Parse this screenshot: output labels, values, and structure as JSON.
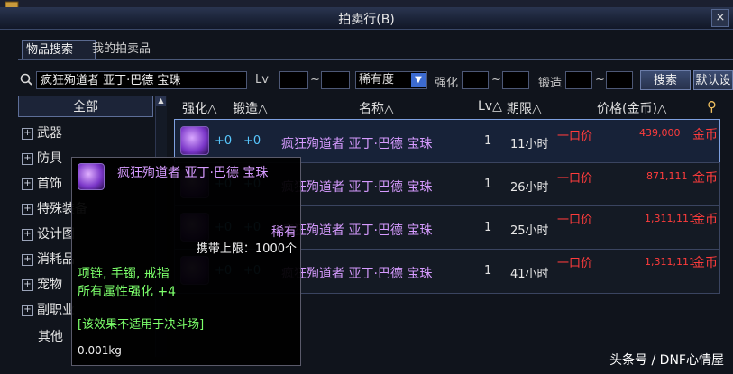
{
  "window": {
    "title": "拍卖行(B)",
    "close_label": "×"
  },
  "tabs": [
    {
      "label": "物品搜索"
    },
    {
      "label": "我的拍卖品"
    }
  ],
  "search": {
    "query": "疯狂殉道者 亚丁·巴德 宝珠",
    "lv_label": "Lv",
    "tilde": "~",
    "rarity_value": "稀有度",
    "enhance_label": "强化",
    "forge_label": "锻造",
    "search_button": "搜索",
    "default_button": "默认设"
  },
  "sidebar": {
    "items": [
      {
        "label": "全部"
      },
      {
        "label": "武器"
      },
      {
        "label": "防具"
      },
      {
        "label": "首饰"
      },
      {
        "label": "特殊装备"
      },
      {
        "label": "设计图"
      },
      {
        "label": "消耗品"
      },
      {
        "label": "宠物"
      },
      {
        "label": "副职业"
      },
      {
        "label": "其他"
      }
    ],
    "plus": "+"
  },
  "columns": {
    "enhance": "强化△",
    "forge": "锻造△",
    "name": "名称△",
    "lv": "Lv△",
    "duration": "期限△",
    "price": "价格(金币)△"
  },
  "listings": [
    {
      "enhance": "+0",
      "forge": "+0",
      "name": "疯狂殉道者 亚丁·巴德 宝珠",
      "lv": "1",
      "duration": "11小时",
      "price_label": "一口价",
      "price": "439,000",
      "currency": "金币"
    },
    {
      "enhance": "+0",
      "forge": "+0",
      "name": "疯狂殉道者 亚丁·巴德 宝珠",
      "lv": "1",
      "duration": "26小时",
      "price_label": "一口价",
      "price": "871,111",
      "currency": "金币"
    },
    {
      "enhance": "+0",
      "forge": "+0",
      "name": "疯狂殉道者 亚丁·巴德 宝珠",
      "lv": "1",
      "duration": "25小时",
      "price_label": "一口价",
      "price": "1,311,111",
      "currency": "金币"
    },
    {
      "enhance": "+0",
      "forge": "+0",
      "name": "疯狂殉道者 亚丁·巴德 宝珠",
      "lv": "1",
      "duration": "41小时",
      "price_label": "一口价",
      "price": "1,311,111",
      "currency": "金币"
    }
  ],
  "tooltip": {
    "name": "疯狂殉道者 亚丁·巴德 宝珠",
    "rarity": "稀有",
    "limit": "携带上限：1000个",
    "slots": "项链, 手镯, 戒指",
    "effect": "所有属性强化 +4",
    "note": "[该效果不适用于决斗场]",
    "weight": "0.001kg"
  },
  "watermark": "头条号 / DNF心情屋"
}
